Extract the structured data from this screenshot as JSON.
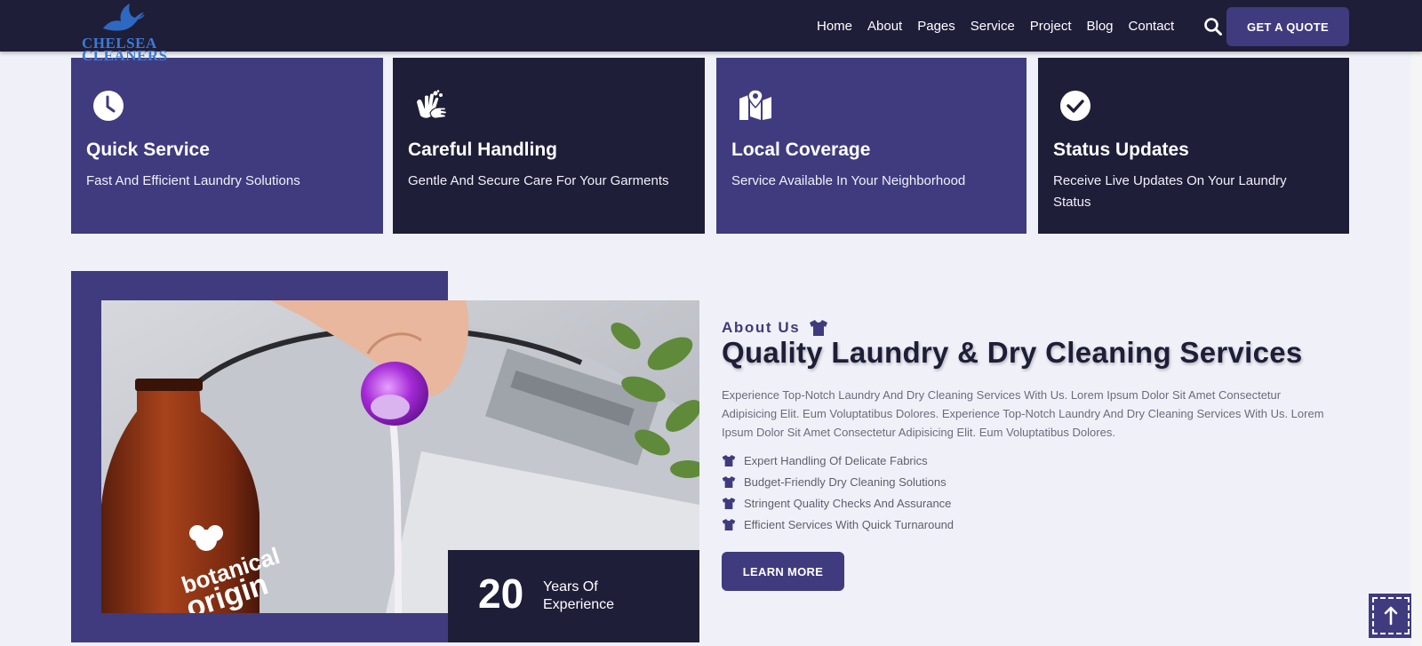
{
  "logo": {
    "text": "CHELSEA\nCLEANERS"
  },
  "nav": {
    "items": [
      "Home",
      "About",
      "Pages",
      "Service",
      "Project",
      "Blog",
      "Contact"
    ],
    "quote_label": "GET A QUOTE"
  },
  "cards": [
    {
      "title": "Quick Service",
      "desc": "Fast And Efficient Laundry Solutions",
      "icon": "clock-icon"
    },
    {
      "title": "Careful Handling",
      "desc": "Gentle And Secure Care For Your Garments",
      "icon": "hand-wash-icon"
    },
    {
      "title": "Local Coverage",
      "desc": "Service Available In Your Neighborhood",
      "icon": "map-pin-icon"
    },
    {
      "title": "Status Updates",
      "desc": "Receive Live Updates On Your Laundry Status",
      "icon": "check-circle-icon"
    }
  ],
  "experience": {
    "number": "20",
    "label": "Years Of Experience"
  },
  "about": {
    "label": "About Us",
    "heading": "Quality Laundry & Dry Cleaning Services",
    "paragraph": "Experience Top-Notch Laundry And Dry Cleaning Services With Us. Lorem Ipsum Dolor Sit Amet Consectetur Adipisicing Elit. Eum Voluptatibus Dolores. Experience Top-Notch Laundry And Dry Cleaning Services With Us. Lorem Ipsum Dolor Sit Amet Consectetur Adipisicing Elit. Eum Voluptatibus Dolores.",
    "points": [
      "Expert Handling Of Delicate Fabrics",
      "Budget-Friendly Dry Cleaning Solutions",
      "Stringent Quality Checks And Assurance",
      "Efficient Services With Quick Turnaround"
    ],
    "button_label": "LEARN MORE"
  },
  "photo": {
    "bottle_text": "botanical\norigin"
  },
  "colors": {
    "primary": "#3f3b7e",
    "dark": "#1f1e39",
    "background": "#f0f1f8"
  }
}
